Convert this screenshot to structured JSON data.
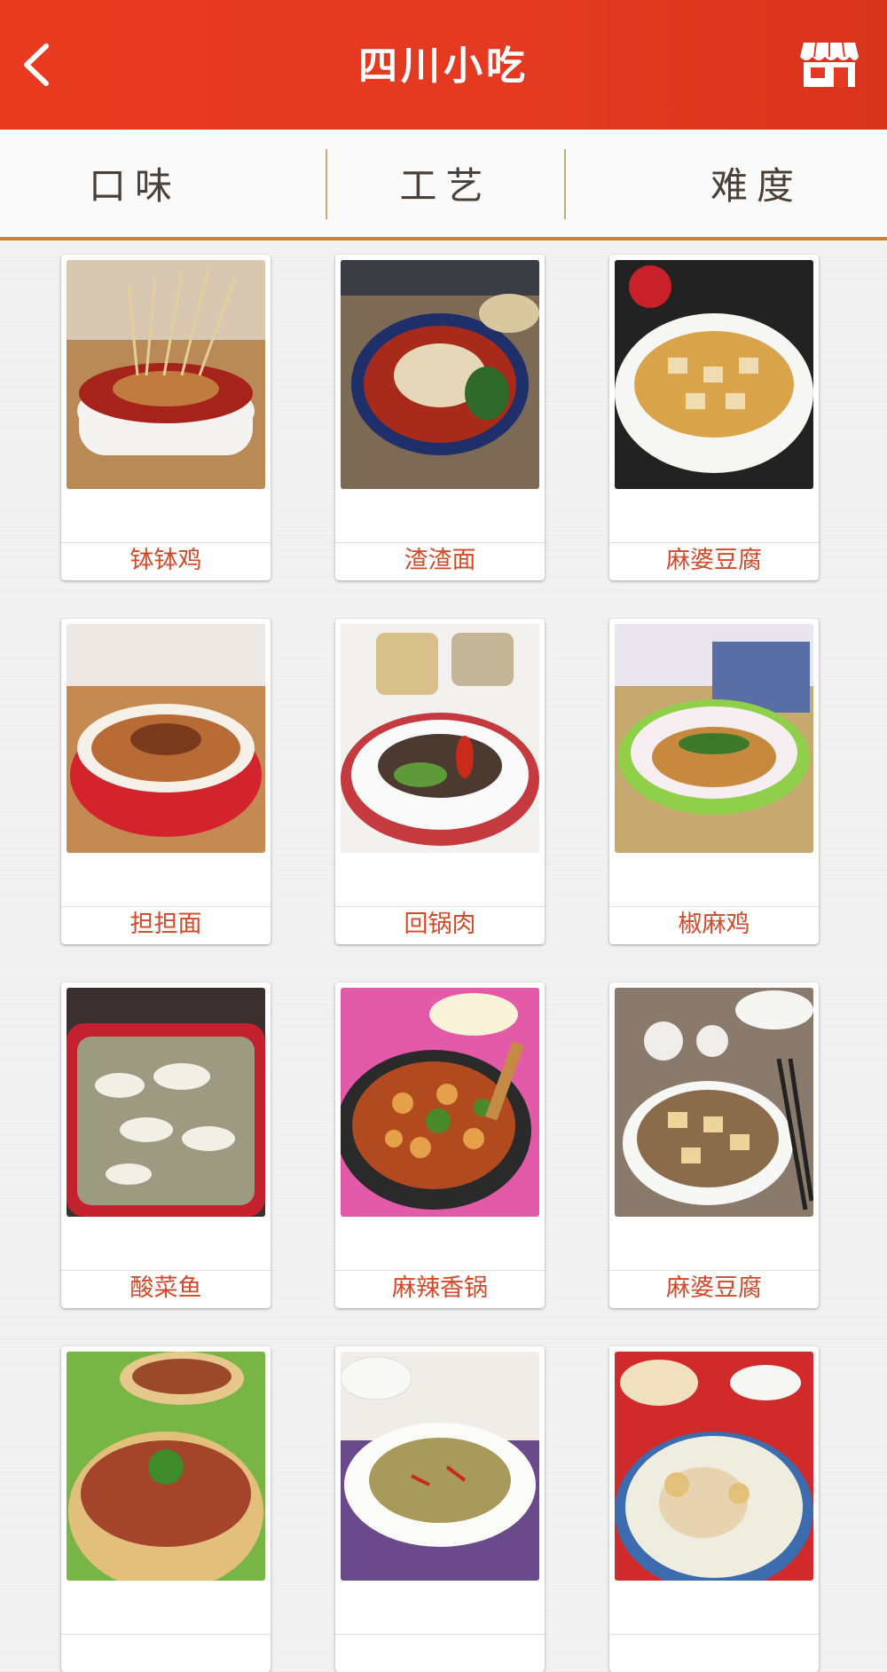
{
  "header": {
    "title": "四川小吃",
    "back_icon": "chevron-left-icon",
    "store_icon": "storefront-icon"
  },
  "tabs": [
    {
      "label": "口味"
    },
    {
      "label": "工艺"
    },
    {
      "label": "难度"
    }
  ],
  "colors": {
    "header": "#e33a21",
    "accent_line": "#c8862a",
    "caption": "#d24a2a"
  },
  "dishes": [
    {
      "name": "钵钵鸡"
    },
    {
      "name": "渣渣面"
    },
    {
      "name": "麻婆豆腐"
    },
    {
      "name": "担担面"
    },
    {
      "name": "回锅肉"
    },
    {
      "name": "椒麻鸡"
    },
    {
      "name": "酸菜鱼"
    },
    {
      "name": "麻辣香锅"
    },
    {
      "name": "麻婆豆腐"
    },
    {
      "name": ""
    },
    {
      "name": ""
    },
    {
      "name": ""
    }
  ]
}
